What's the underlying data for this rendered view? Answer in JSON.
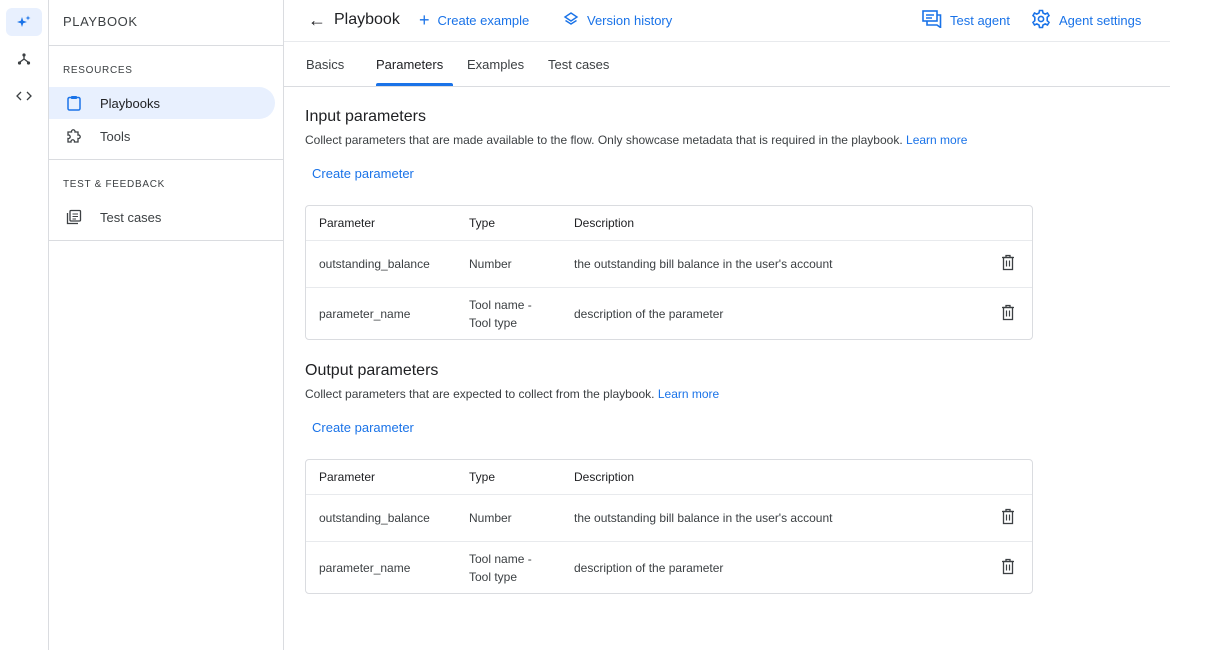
{
  "rail": {
    "items": [
      {
        "icon": "sparkle-icon",
        "active": true
      },
      {
        "icon": "flow-icon",
        "active": false
      },
      {
        "icon": "code-icon",
        "active": false
      }
    ]
  },
  "sidenav": {
    "title": "PLAYBOOK",
    "resources_label": "RESOURCES",
    "resources": [
      {
        "label": "Playbooks",
        "icon": "clipboard-icon",
        "active": true
      },
      {
        "label": "Tools",
        "icon": "puzzle-icon",
        "active": false
      }
    ],
    "feedback_label": "TEST & FEEDBACK",
    "feedback": [
      {
        "label": "Test cases",
        "icon": "test-cases-icon",
        "active": false
      }
    ]
  },
  "topbar": {
    "back_title": "Playbook",
    "create_example": "Create example",
    "version_history": "Version history",
    "test_agent": "Test agent",
    "agent_settings": "Agent settings"
  },
  "tabs": [
    {
      "label": "Basics",
      "active": false
    },
    {
      "label": "Parameters",
      "active": true
    },
    {
      "label": "Examples",
      "active": false
    },
    {
      "label": "Test cases",
      "active": false
    }
  ],
  "input_section": {
    "title": "Input parameters",
    "description": "Collect parameters that are made available to the flow. Only showcase metadata that is required in the playbook.",
    "learn_more": "Learn more",
    "create_label": "Create parameter",
    "columns": [
      "Parameter",
      "Type",
      "Description"
    ],
    "rows": [
      {
        "parameter": "outstanding_balance",
        "type_line1": "Number",
        "type_line2": "",
        "description": "the outstanding bill balance in the user's account"
      },
      {
        "parameter": "parameter_name",
        "type_line1": "Tool name -",
        "type_line2": "Tool type",
        "description": "description of the parameter"
      }
    ]
  },
  "output_section": {
    "title": "Output parameters",
    "description": "Collect parameters that are expected to collect from the playbook.",
    "learn_more": "Learn more",
    "create_label": "Create parameter",
    "columns": [
      "Parameter",
      "Type",
      "Description"
    ],
    "rows": [
      {
        "parameter": "outstanding_balance",
        "type_line1": "Number",
        "type_line2": "",
        "description": "the outstanding bill balance in the user's account"
      },
      {
        "parameter": "parameter_name",
        "type_line1": "Tool name -",
        "type_line2": "Tool type",
        "description": "description of the parameter"
      }
    ]
  },
  "colors": {
    "accent": "#1a73e8",
    "active_bg": "#e8f0fe",
    "divider": "#dadce0"
  }
}
